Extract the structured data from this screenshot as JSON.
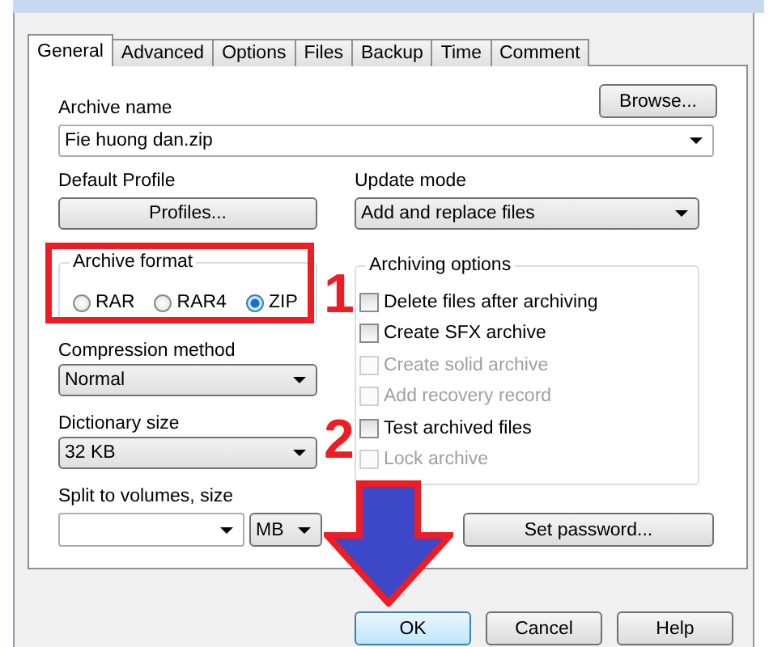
{
  "tabs": [
    {
      "label": "General",
      "selected": true
    },
    {
      "label": "Advanced",
      "selected": false
    },
    {
      "label": "Options",
      "selected": false
    },
    {
      "label": "Files",
      "selected": false
    },
    {
      "label": "Backup",
      "selected": false
    },
    {
      "label": "Time",
      "selected": false
    },
    {
      "label": "Comment",
      "selected": false
    }
  ],
  "archive_name": {
    "label": "Archive name",
    "value": "Fie huong dan.zip",
    "browse_button": "Browse..."
  },
  "default_profile": {
    "label": "Default Profile",
    "button": "Profiles..."
  },
  "update_mode": {
    "label": "Update mode",
    "value": "Add and replace files"
  },
  "archive_format": {
    "label": "Archive format",
    "options": [
      {
        "label": "RAR",
        "selected": false
      },
      {
        "label": "RAR4",
        "selected": false
      },
      {
        "label": "ZIP",
        "selected": true
      }
    ]
  },
  "compression_method": {
    "label": "Compression method",
    "value": "Normal"
  },
  "dictionary_size": {
    "label": "Dictionary size",
    "value": "32 KB"
  },
  "split_volumes": {
    "label": "Split to volumes, size",
    "unit": "MB"
  },
  "archiving_options": {
    "label": "Archiving options",
    "items": [
      {
        "label": "Delete files after archiving",
        "checked": false,
        "disabled": false
      },
      {
        "label": "Create SFX archive",
        "checked": false,
        "disabled": false
      },
      {
        "label": "Create solid archive",
        "checked": false,
        "disabled": true
      },
      {
        "label": "Add recovery record",
        "checked": false,
        "disabled": true
      },
      {
        "label": "Test archived files",
        "checked": false,
        "disabled": false
      },
      {
        "label": "Lock archive",
        "checked": false,
        "disabled": true
      }
    ]
  },
  "set_password_button": "Set password...",
  "buttons": [
    {
      "label": "OK",
      "default": true
    },
    {
      "label": "Cancel",
      "default": false
    },
    {
      "label": "Help",
      "default": false
    }
  ],
  "step_markers": [
    "1",
    "2"
  ]
}
